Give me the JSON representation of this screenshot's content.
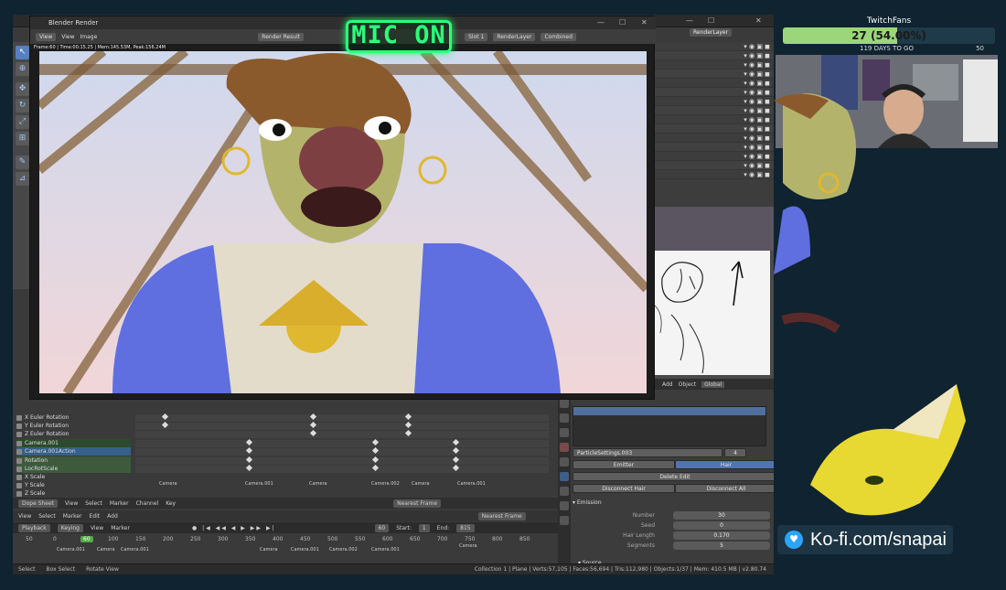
{
  "mic_sign": "MIC ON",
  "blender": {
    "render_window": {
      "title": "Blender Render",
      "menu": {
        "view": "View",
        "view2": "View",
        "image": "Image",
        "render_result": "Render Result",
        "slot": "Slot 1",
        "layer": "RenderLayer",
        "pass": "Combined"
      },
      "info": "Frame:60 | Time:00:15.25 | Mem:145.53M, Peak:156.24M"
    },
    "top_right_layer": "RenderLayer",
    "dopesheet": {
      "channels": [
        {
          "label": "X Euler Rotation"
        },
        {
          "label": "Y Euler Rotation"
        },
        {
          "label": "Z Euler Rotation"
        },
        {
          "label": "Camera.001"
        },
        {
          "label": "Camera.001Action"
        },
        {
          "label": "Rotation"
        },
        {
          "label": "LocRotScale"
        },
        {
          "label": "X Scale"
        },
        {
          "label": "Y Scale"
        },
        {
          "label": "Z Scale"
        }
      ],
      "markers_top": [
        "Camera",
        "Camera.001",
        "Camera",
        "Camera.002",
        "Camera",
        "Camera.001"
      ],
      "header": {
        "editor": "Dope Sheet",
        "view": "View",
        "select": "Select",
        "marker": "Marker",
        "channel": "Channel",
        "key": "Key",
        "snap": "Nearest Frame"
      },
      "header2": {
        "view": "View",
        "select": "Select",
        "marker": "Marker",
        "edit": "Edit",
        "add": "Add",
        "snap": "Nearest Frame"
      },
      "timeline": {
        "playback": "Playback",
        "keying": "Keying",
        "view": "View",
        "marker": "Marker",
        "current": "60",
        "start_label": "Start:",
        "start": "1",
        "end_label": "End:",
        "end": "815"
      },
      "ruler": [
        "50",
        "0",
        "60",
        "100",
        "150",
        "200",
        "250",
        "300",
        "350",
        "400",
        "450",
        "500",
        "550",
        "600",
        "650",
        "700",
        "750",
        "800",
        "850"
      ],
      "markers_bottom": [
        "Camera.001",
        "Camera",
        "Camera.001",
        "Camera",
        "Camera.001",
        "Camera.002",
        "Camera.001",
        "Camera"
      ]
    },
    "properties": {
      "particle": "ParticleSettings.003",
      "count": "4",
      "tabs": [
        "Emitter",
        "Hair"
      ],
      "delete_edit": "Delete Edit",
      "disconnect_hair": "Disconnect Hair",
      "disconnect_all": "Disconnect All",
      "section": "Emission",
      "fields": [
        {
          "label": "Number",
          "value": "30"
        },
        {
          "label": "Seed",
          "value": "0"
        },
        {
          "label": "Hair Length",
          "value": "0.170"
        },
        {
          "label": "Segments",
          "value": "5"
        }
      ],
      "source": "Source"
    },
    "editor_footer": {
      "add": "Add",
      "object": "Object",
      "global": "Global"
    },
    "status": {
      "select": "Select",
      "box_select": "Box Select",
      "rotate_view": "Rotate View",
      "stats": "Collection 1 | Plane | Verts:57,105 | Faces:56,694 | Tris:112,980 | Objects:1/37 | Mem: 410.5 MB | v2.80.74"
    }
  },
  "overlay": {
    "goal_title": "TwitchFans",
    "goal_progress": 0.54,
    "goal_text": "27 (54.00%)",
    "days_to_go": "119 DAYS TO GO",
    "goal_target": "50",
    "kofi": "Ko-fi.com/snapai"
  },
  "colors": {
    "mic": "#2bff7c",
    "goal_fill": "#9cd67a",
    "kofi_icon": "#2aa5ff"
  }
}
